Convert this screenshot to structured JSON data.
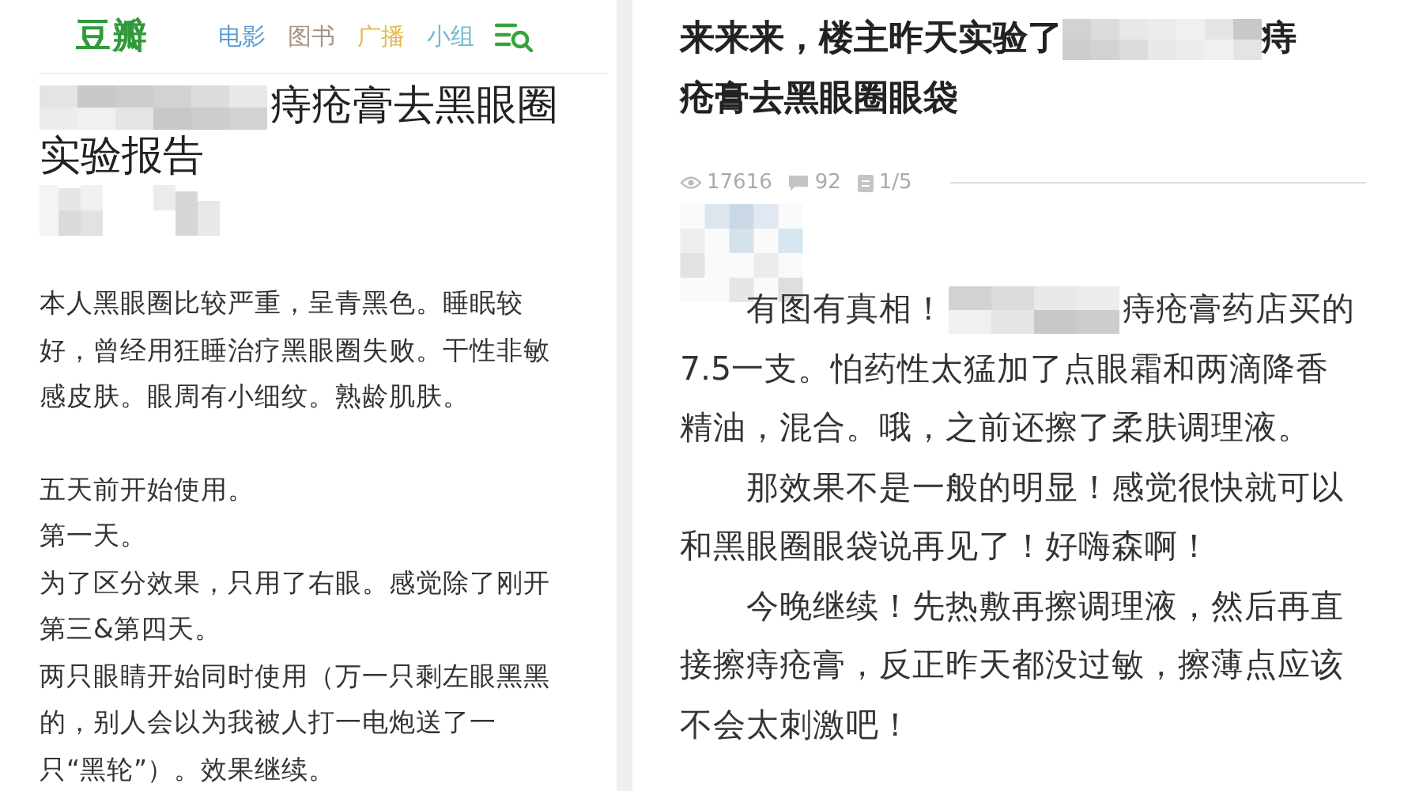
{
  "left_page": {
    "logo": "豆瓣",
    "nav": [
      {
        "label": "电影",
        "color": "#5a9bd4"
      },
      {
        "label": "图书",
        "color": "#a89484"
      },
      {
        "label": "广播",
        "color": "#e6b84e"
      },
      {
        "label": "小组",
        "color": "#73b8d0"
      }
    ],
    "title_lines": [
      [
        {
          "kind": "redacted"
        },
        {
          "kind": "text",
          "text": "痔疮膏去黑眼圈"
        }
      ],
      [
        {
          "kind": "text",
          "text": "实验报告"
        }
      ]
    ],
    "author_avatar": {
      "kind": "picture"
    },
    "paragraphs": [
      {
        "lines": [
          "本人黑眼圈比较严重，呈青黑色。睡眠较",
          "好，曾经用狂睡治疗黑眼圈失败。干性非敏",
          "感皮肤。眼周有小细纹。熟龄肌肤。"
        ]
      },
      {
        "lines": [
          "五天前开始使用。",
          "第一天。",
          "为了区分效果，只用了右眼。感觉除了刚开",
          "第三&第四天。",
          "两只眼睛开始同时使用（万一只剩左眼黑黑",
          "的，别人会以为我被人打一电炮送了一",
          "只“黑轮”）。效果继续。"
        ]
      }
    ]
  },
  "right_page": {
    "title_lines": [
      [
        {
          "kind": "text",
          "text": "来来来，楼主昨天实验了"
        },
        {
          "kind": "redacted"
        },
        {
          "kind": "text",
          "text": "痔"
        }
      ],
      [
        {
          "kind": "text",
          "text": "疮膏去黑眼圈眼袋"
        }
      ]
    ],
    "stats": [
      {
        "kind": "views",
        "text": "17616"
      },
      {
        "kind": "comments",
        "text": "92"
      },
      {
        "kind": "pages",
        "text": "1/5"
      }
    ],
    "author_avatar": {
      "kind": "picture"
    },
    "paragraphs": [
      {
        "lines": [
          [
            {
              "kind": "text",
              "text": "有图有真相！"
            },
            {
              "kind": "redacted"
            },
            {
              "kind": "text",
              "text": "痔疮膏药店买的"
            }
          ],
          [
            {
              "kind": "text",
              "text": "7.5一支。怕药性太猛加了点眼霜和两滴降香"
            }
          ],
          [
            {
              "kind": "text",
              "text": "精油，混合。哦，之前还擦了柔肤调理液。"
            }
          ]
        ]
      },
      {
        "lines": [
          [
            {
              "kind": "text",
              "text": "那效果不是一般的明显！感觉很快就可以"
            }
          ],
          [
            {
              "kind": "text",
              "text": "和黑眼圈眼袋说再见了！好嗨森啊！"
            }
          ]
        ]
      },
      {
        "lines": [
          [
            {
              "kind": "text",
              "text": "今晚继续！先热敷再擦调理液，然后再直"
            }
          ],
          [
            {
              "kind": "text",
              "text": "接擦痔疮膏，反正昨天都没过敏，擦薄点应该"
            }
          ],
          [
            {
              "kind": "text",
              "text": "不会太刺激吧！"
            }
          ]
        ]
      }
    ]
  }
}
